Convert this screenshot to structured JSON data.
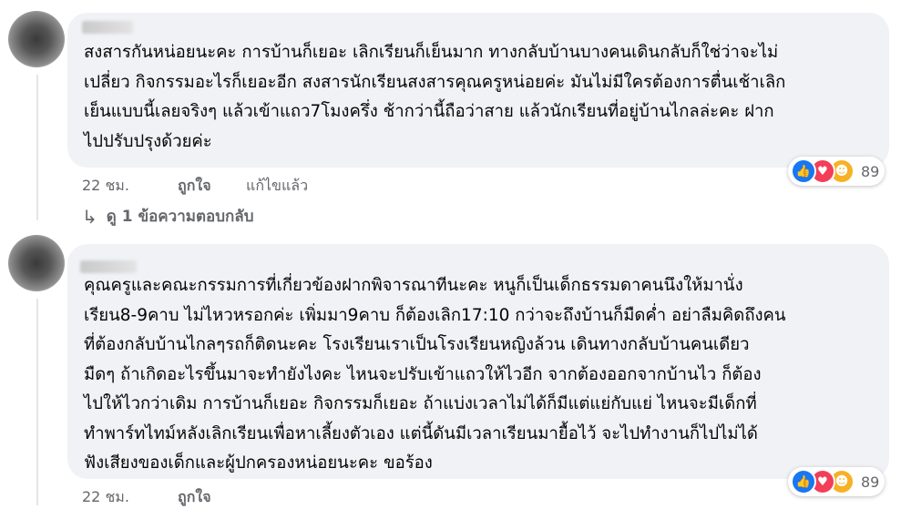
{
  "comments": [
    {
      "text_lines": [
        "สงสารกันหน่อยนะคะ การบ้านก็เยอะ เลิกเรียนก็เย็นมาก ทางกลับบ้านบางคนเดินกลับก็ใช่ว่าจะไม่",
        "เปลี่ยว กิจกรรมอะไรก็เยอะอีก สงสารนักเรียนสงสารคุณครูหน่อยค่ะ มันไม่มีใครต้องการตื่นเช้าเลิก",
        "เย็นแบบนี้เลยจริงๆ แล้วเข้าแถว7โมงครึ่ง ช้ากว่านี้ถือว่าสาย แล้วนักเรียนที่อยู่บ้านไกลล่ะคะ ฝาก",
        "ไปปรับปรุงด้วยค่ะ"
      ],
      "time": "22 ชม.",
      "like_label": "ถูกใจ",
      "edited_label": "แก้ไขแล้ว",
      "reaction_count": "89",
      "reactions": [
        "like-icon",
        "love-icon",
        "care-icon"
      ],
      "replies_label": "ดู 1 ข้อความตอบกลับ"
    },
    {
      "text_lines": [
        "คุณครูและคณะกรรมการที่เกี่ยวข้องฝากพิจารณาทีนะคะ หนูก็เป็นเด็กธรรมดาคนนึงให้มานั่ง",
        "เรียน8-9คาบ ไม่ไหวหรอกค่ะ เพิ่มมา9คาบ ก็ต้องเลิก17:10 กว่าจะถึงบ้านก็มืดค่ำ อย่าลืมคิดถึงคน",
        "ที่ต้องกลับบ้านไกลๆรถก็ติดนะคะ โรงเรียนเราเป็นโรงเรียนหญิงล้วน เดินทางกลับบ้านคนเดียว",
        "มืดๆ ถ้าเกิดอะไรขึ้นมาจะทำยังไงคะ ไหนจะปรับเข้าแถวให้ไวอีก จากต้องออกจากบ้านไว ก็ต้อง",
        "ไปให้ไวกว่าเดิม การบ้านก็เยอะ กิจกรรมก็เยอะ ถ้าแบ่งเวลาไม่ได้ก็มีแต่แย่กับแย่ ไหนจะมีเด็กที่",
        "ทำพาร์ทไทม์หลังเลิกเรียนเพื่อหาเลี้ยงตัวเอง แต่นี้ดันมีเวลาเรียนมายื้อไว้ จะไปทำงานก็ไปไม่ได้",
        "ฟังเสียงของเด็กและผู้ปกครองหน่อยนะคะ ขอร้อง"
      ],
      "time": "22 ชม.",
      "like_label": "ถูกใจ",
      "reaction_count": "89",
      "reactions": [
        "like-icon",
        "love-icon",
        "care-icon"
      ]
    }
  ],
  "colors": {
    "bubble": "#f0f2f5",
    "meta_text": "#65676b",
    "like_blue": "#1877f2",
    "love_red": "#f33e58",
    "care_yellow": "#f7b125"
  }
}
